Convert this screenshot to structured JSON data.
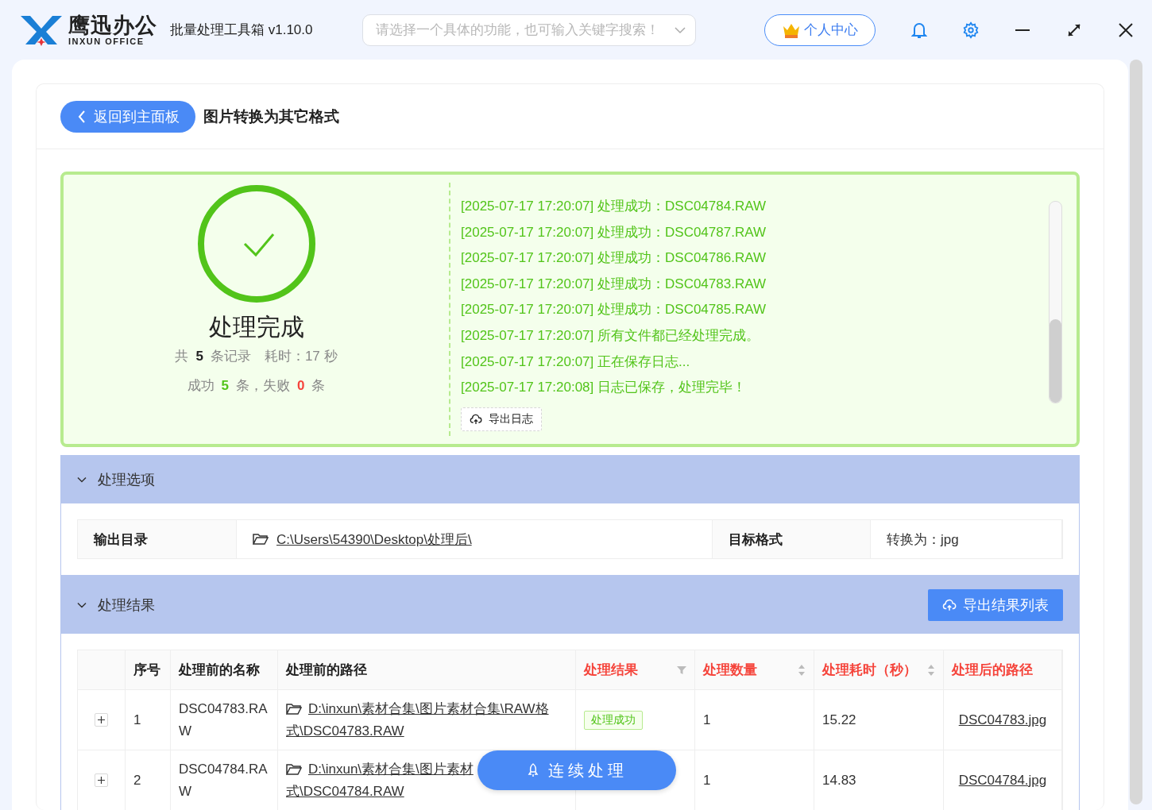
{
  "app": {
    "logo_name": "鹰迅办公",
    "logo_sub": "INXUN OFFICE",
    "title": "批量处理工具箱 v1.10.0"
  },
  "search": {
    "placeholder": "请选择一个具体的功能，也可输入关键字搜索！"
  },
  "user_button": "个人中心",
  "page": {
    "back_button": "返回到主面板",
    "title": "图片转换为其它格式"
  },
  "summary": {
    "status": "处理完成",
    "total_prefix": "共",
    "total": "5",
    "total_suffix": "条记录",
    "time": "耗时：17 秒",
    "success_prefix": "成功",
    "success": "5",
    "middle": "条，失败",
    "failed": "0",
    "failed_suffix": "条"
  },
  "log": {
    "lines": [
      "[2025-07-17 17:20:07] 处理成功：DSC04784.RAW",
      "[2025-07-17 17:20:07] 处理成功：DSC04787.RAW",
      "[2025-07-17 17:20:07] 处理成功：DSC04786.RAW",
      "[2025-07-17 17:20:07] 处理成功：DSC04783.RAW",
      "[2025-07-17 17:20:07] 处理成功：DSC04785.RAW",
      "[2025-07-17 17:20:07] 所有文件都已经处理完成。",
      "[2025-07-17 17:20:07] 正在保存日志...",
      "[2025-07-17 17:20:08] 日志已保存，处理完毕！"
    ],
    "export_button": "导出日志"
  },
  "options": {
    "title": "处理选项",
    "expanded": true,
    "fields": [
      {
        "label": "输出目录",
        "value": "C:\\Users\\54390\\Desktop\\处理后\\",
        "kind": "path"
      },
      {
        "label": "目标格式",
        "value": "转换为：jpg",
        "kind": "text"
      }
    ]
  },
  "results": {
    "title": "处理结果",
    "expanded": true,
    "export_button": "导出结果列表",
    "columns": [
      {
        "label": "序号",
        "kind": "plain",
        "highlight": false
      },
      {
        "label": "处理前的名称",
        "kind": "plain",
        "highlight": false
      },
      {
        "label": "处理前的路径",
        "kind": "plain",
        "highlight": false
      },
      {
        "label": "处理结果",
        "kind": "filter",
        "highlight": true
      },
      {
        "label": "处理数量",
        "kind": "sort",
        "highlight": true
      },
      {
        "label": "处理耗时（秒）",
        "kind": "sort",
        "highlight": true
      },
      {
        "label": "处理后的路径",
        "kind": "plain",
        "highlight": true
      }
    ],
    "rows": [
      {
        "index": "1",
        "name": "DSC04783.RAW",
        "path_lines": [
          "D:\\inxun\\素材合集\\图片素材合集\\RAW格",
          "式\\DSC04783.RAW"
        ],
        "result": "处理成功",
        "count": "1",
        "time": "15.22",
        "output": "DSC04783.jpg"
      },
      {
        "index": "2",
        "name": "DSC04784.RAW",
        "path_lines": [
          "D:\\inxun\\素材合集\\图片素材",
          "式\\DSC04784.RAW"
        ],
        "count": "1",
        "time": "14.83",
        "output": "DSC04784.jpg"
      }
    ]
  },
  "float_button": "连续处理"
}
